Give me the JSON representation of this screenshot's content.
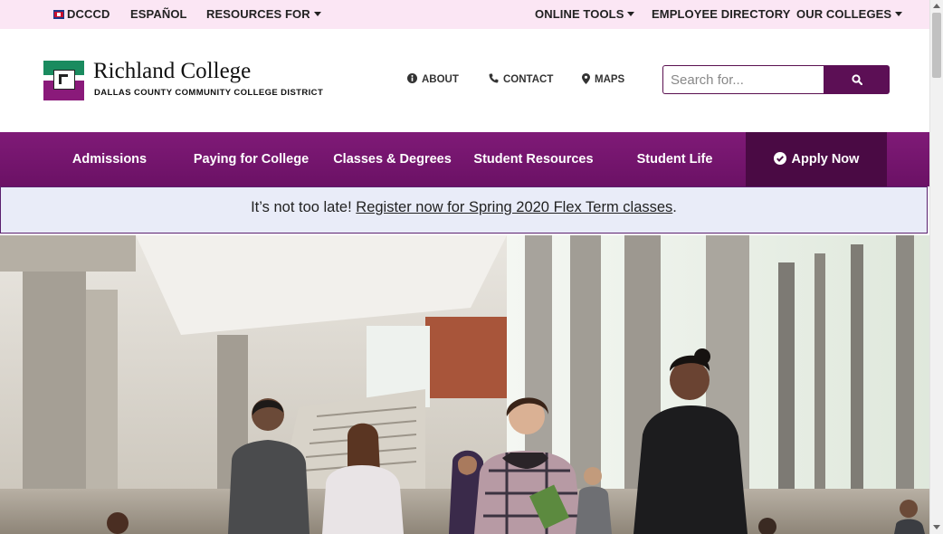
{
  "topbar": {
    "left": [
      {
        "label": "DCCCD",
        "icon": "dcccd-flag-icon"
      },
      {
        "label": "ESPAÑOL"
      },
      {
        "label": "RESOURCES FOR",
        "dropdown": true
      }
    ],
    "right": [
      {
        "label": "ONLINE TOOLS",
        "dropdown": true
      },
      {
        "label": "EMPLOYEE DIRECTORY"
      },
      {
        "label": "OUR COLLEGES",
        "dropdown": true
      }
    ]
  },
  "logo": {
    "title": "Richland College",
    "subtitle": "DALLAS COUNTY COMMUNITY COLLEGE DISTRICT"
  },
  "header_links": [
    {
      "label": "ABOUT",
      "icon": "info-circle-icon"
    },
    {
      "label": "CONTACT",
      "icon": "phone-icon"
    },
    {
      "label": "MAPS",
      "icon": "map-marker-icon"
    }
  ],
  "search": {
    "placeholder": "Search for...",
    "button_icon": "search-icon"
  },
  "mainnav": {
    "items": [
      "Admissions",
      "Paying for College",
      "Classes & Degrees",
      "Student Resources",
      "Student Life"
    ],
    "cta": {
      "label": "Apply Now",
      "icon": "check-circle-icon"
    }
  },
  "alert": {
    "prefix": "It’s not too late! ",
    "link": "Register now for Spring 2020 Flex Term classes",
    "suffix": "."
  },
  "hero": {
    "image": "students-walking-campus-atrium-photo"
  },
  "colors": {
    "topbar_bg": "#fbe6f4",
    "nav_purple": "#7f1a77",
    "apply_dark": "#4a0a44",
    "search_btn": "#5c0f55",
    "alert_bg": "#e9ecf8",
    "logo_green": "#1a8b5f",
    "logo_purple": "#8a1a7a"
  }
}
